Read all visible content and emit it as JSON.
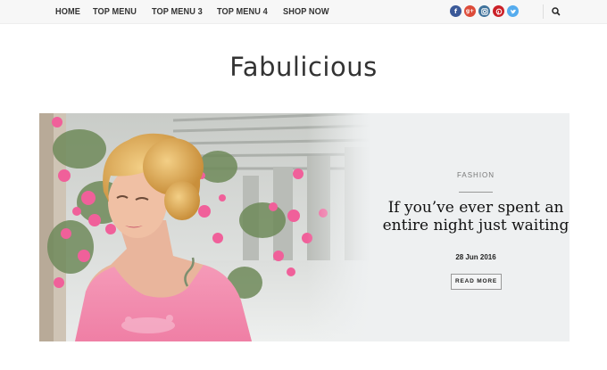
{
  "nav": {
    "items": [
      "HOME",
      "TOP MENU",
      "TOP MENU 3",
      "TOP MENU 4",
      "SHOP NOW"
    ]
  },
  "social": [
    {
      "icon": "facebook-icon",
      "glyph": "f",
      "color": "#3b5998"
    },
    {
      "icon": "google-plus-icon",
      "glyph": "g+",
      "color": "#dd4b39"
    },
    {
      "icon": "instagram-icon",
      "glyph": "◙",
      "color": "#3f729b"
    },
    {
      "icon": "pinterest-icon",
      "glyph": "P",
      "color": "#cb2027"
    },
    {
      "icon": "twitter-icon",
      "glyph": "t",
      "color": "#55acee"
    }
  ],
  "search": {
    "icon": "search-icon"
  },
  "brand": {
    "logo_text": "Fabulicious"
  },
  "featured": {
    "category": "FASHION",
    "title": "If you’ve ever spent an entire night just waiting",
    "date": "28 Jun 2016",
    "read_more": "READ MORE"
  },
  "colors": {
    "accent_pink": "#f07aa5",
    "panel_bg": "#eef0f1"
  }
}
